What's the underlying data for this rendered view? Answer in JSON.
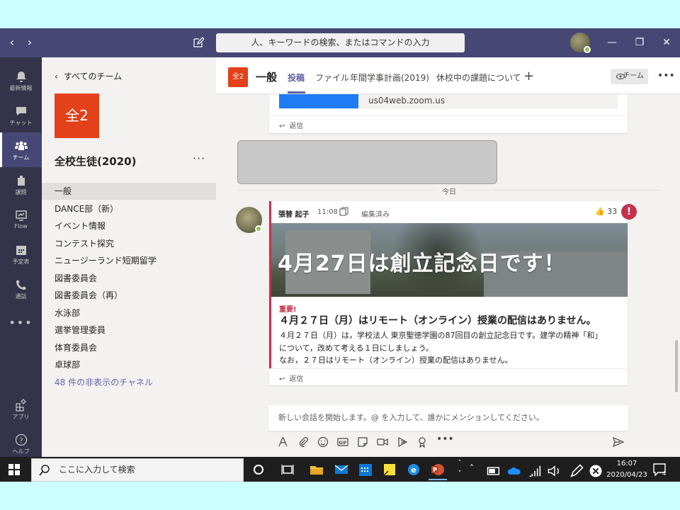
{
  "window": {
    "search_placeholder": "人、キーワードの検索、またはコマンドの入力"
  },
  "rail": [
    {
      "label": "最新情報",
      "icon": "bell-icon"
    },
    {
      "label": "チャット",
      "icon": "chat-icon"
    },
    {
      "label": "チーム",
      "icon": "teams-icon",
      "active": true
    },
    {
      "label": "課題",
      "icon": "assignments-icon"
    },
    {
      "label": "Flow",
      "icon": "flow-icon"
    },
    {
      "label": "予定表",
      "icon": "calendar-icon"
    },
    {
      "label": "通話",
      "icon": "phone-icon"
    },
    {
      "label": "アプリ",
      "icon": "apps-icon"
    },
    {
      "label": "ヘルプ",
      "icon": "help-icon"
    }
  ],
  "team": {
    "back_label": "すべてのチーム",
    "tile": "全2",
    "name": "全校生徒(2020)",
    "channels": [
      "一般",
      "DANCE部（新）",
      "イベント情報",
      "コンテスト探究",
      "ニュージーランド短期留学",
      "図書委員会",
      "図書委員会（再）",
      "水泳部",
      "選挙管理委員",
      "体育委員会",
      "卓球部"
    ],
    "hidden_channels": "48 件の非表示のチャネル"
  },
  "header": {
    "tile": "全2",
    "title": "一般",
    "tabs": [
      "投稿",
      "ファイル",
      "年間学事計画(2019)",
      "休校中の課題について"
    ],
    "add_tab": "+",
    "team_button": "チーム"
  },
  "conversation": {
    "prev_link": "us04web.zoom.us",
    "reply_label": "返信",
    "today_label": "今日",
    "post": {
      "author": "張替 起子",
      "time": "11:08",
      "edited": "編集済み",
      "likes": "33",
      "banner_text": "4月27日は創立記念日です！",
      "important": "重要!",
      "subject": "４月２７日（月）はリモート（オンライン）授業の配信はありません。",
      "body": [
        "４月２７日（月）は，学校法人 東京聖徳学園の87回目の創立記念日です。建学の精神「和」",
        "について，改めて考える１日にしましょう。",
        "なお，２７日はリモート（オンライン）授業の配信はありません。"
      ]
    }
  },
  "compose": {
    "placeholder": "新しい会話を開始します。@ を入力して、誰かにメンションしてください。"
  },
  "taskbar": {
    "search_placeholder": "ここに入力して検索",
    "time": "16:07",
    "date": "2020/04/23",
    "notifications": "4"
  },
  "colors": {
    "titlebar": "#464775",
    "rail": "#33344a",
    "accent": "#6264a7",
    "team_tile": "#e2411a",
    "important": "#c4314b"
  }
}
